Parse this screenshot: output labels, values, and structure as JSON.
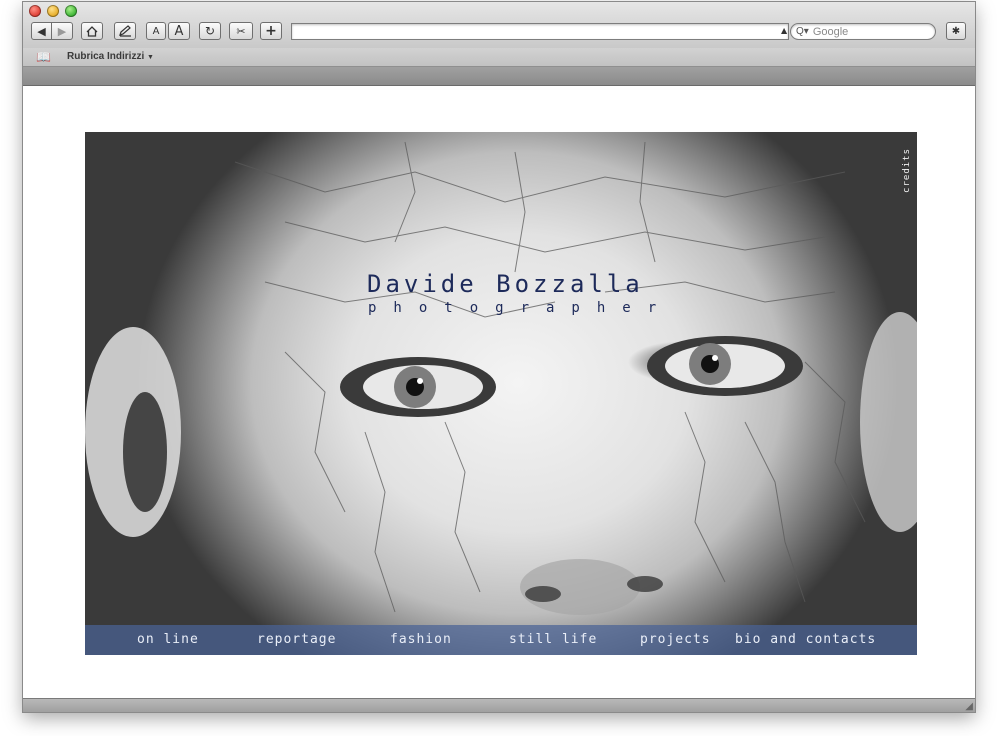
{
  "browser": {
    "bookmarks_bar": {
      "item_label": "Rubrica Indirizzi"
    },
    "search": {
      "placeholder": "Google"
    }
  },
  "site": {
    "title": "Davide Bozzalla",
    "subtitle": "photographer",
    "credits_label": "credits",
    "nav": [
      {
        "label": "on line"
      },
      {
        "label": "reportage"
      },
      {
        "label": "fashion"
      },
      {
        "label": "still life"
      },
      {
        "label": "projects"
      },
      {
        "label": "bio and contacts"
      }
    ]
  },
  "icons": {
    "close": "red-circle",
    "minimize": "yellow-circle",
    "maximize": "green-circle",
    "back": "left-triangle",
    "forward": "right-triangle",
    "home": "house",
    "edit": "pencil",
    "text_smaller": "A",
    "text_larger": "A",
    "reload": "circular-arrow",
    "snapback": "scissors",
    "add_bookmark": "plus",
    "search": "magnifier",
    "bug": "bug",
    "bookmarks": "open-book"
  },
  "colors": {
    "title_text": "#1d2a5a",
    "menu_bar": "#4a6296",
    "menu_text": "#e9eef8"
  }
}
